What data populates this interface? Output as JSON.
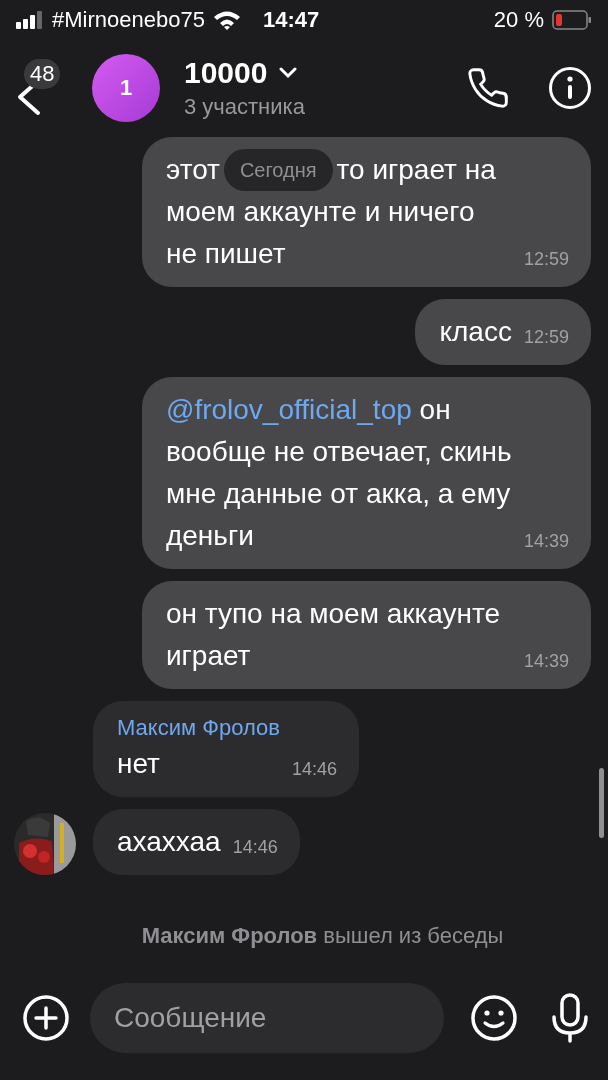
{
  "status_bar": {
    "carrier": "#Mirnoenebo75",
    "time": "14:47",
    "battery": "20 %"
  },
  "header": {
    "back_badge": "48",
    "avatar_letter": "1",
    "title": "10000",
    "subtitle": "3 участника"
  },
  "messages": [
    {
      "kind": "outgoing",
      "text": "этот",
      "date_pill": "Сегодня",
      "text_after": "то играет на",
      "text_cont": "моем аккаунте и ничего не пишет",
      "time": "12:59"
    },
    {
      "kind": "outgoing",
      "text": "класс",
      "time": "12:59"
    },
    {
      "kind": "outgoing",
      "mention": "@frolov_official_top",
      "text": "он вообще не отвечает, скинь мне данные от акка, а ему деньги",
      "time": "14:39"
    },
    {
      "kind": "outgoing",
      "text": "он тупо на моем аккаунте играет",
      "time": "14:39"
    },
    {
      "kind": "incoming",
      "sender": "Максим Фролов",
      "text": "нет",
      "time": "14:46"
    },
    {
      "kind": "incoming",
      "text": "ахаххаа",
      "time": "14:46"
    },
    {
      "kind": "system",
      "actor": "Максим Фролов",
      "text": "вышел из беседы"
    }
  ],
  "composer": {
    "placeholder": "Сообщение"
  }
}
